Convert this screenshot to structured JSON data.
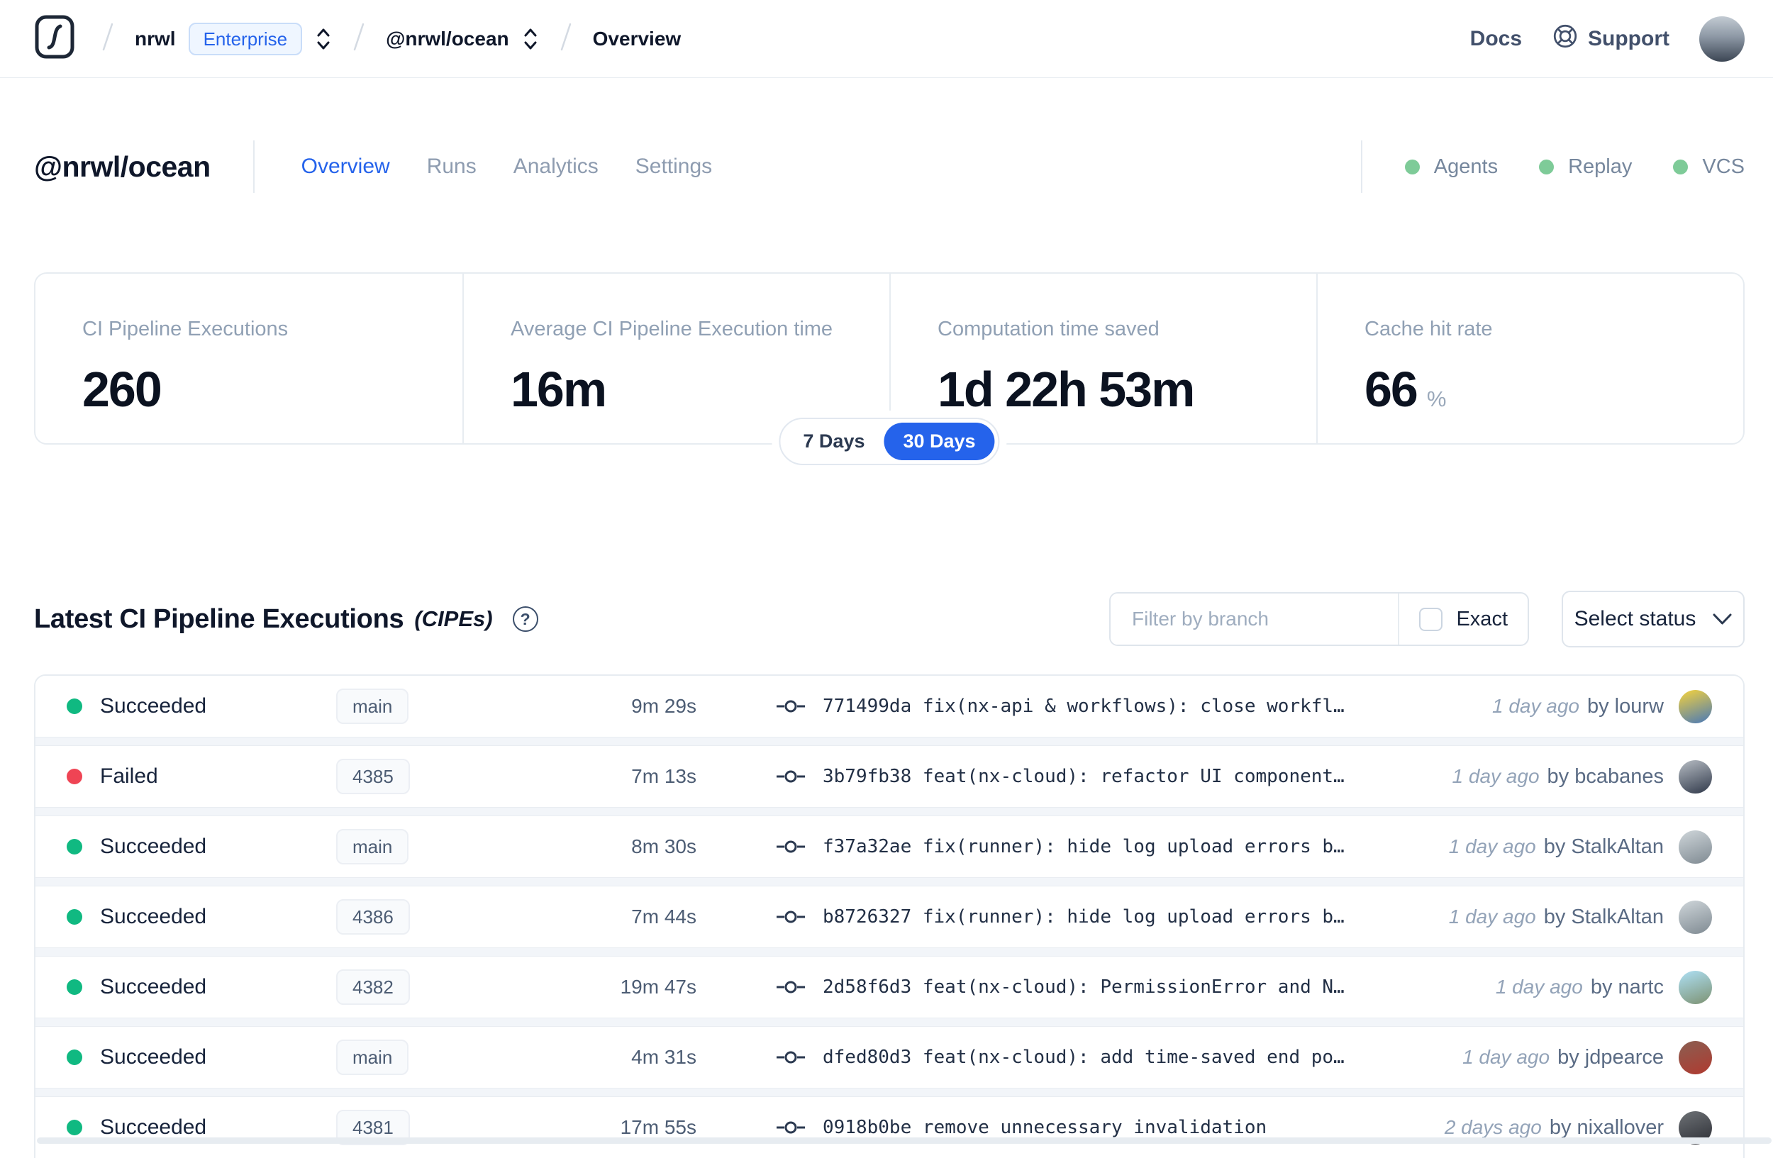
{
  "nav": {
    "breadcrumb": {
      "org": "nrwl",
      "org_badge": "Enterprise",
      "workspace": "@nrwl/ocean",
      "page": "Overview"
    },
    "links": {
      "docs": "Docs",
      "support": "Support"
    }
  },
  "workspace_header": {
    "title": "@nrwl/ocean",
    "tabs": [
      {
        "label": "Overview",
        "active": true
      },
      {
        "label": "Runs",
        "active": false
      },
      {
        "label": "Analytics",
        "active": false
      },
      {
        "label": "Settings",
        "active": false
      }
    ],
    "integrations": [
      {
        "label": "Agents"
      },
      {
        "label": "Replay"
      },
      {
        "label": "VCS"
      }
    ]
  },
  "stats": {
    "cards": [
      {
        "label": "CI Pipeline Executions",
        "value": "260",
        "unit": ""
      },
      {
        "label": "Average CI Pipeline Execution time",
        "value": "16m",
        "unit": ""
      },
      {
        "label": "Computation time saved",
        "value": "1d 22h 53m",
        "unit": ""
      },
      {
        "label": "Cache hit rate",
        "value": "66",
        "unit": "%"
      }
    ],
    "range_toggle": {
      "options": [
        "7 Days",
        "30 Days"
      ],
      "selected": "30 Days"
    }
  },
  "cipes": {
    "title": "Latest CI Pipeline Executions",
    "title_suffix": "(CIPEs)",
    "help_glyph": "?",
    "filter": {
      "placeholder": "Filter by branch",
      "exact_label": "Exact",
      "status_label": "Select status"
    },
    "rows": [
      {
        "status": "Succeeded",
        "result": "succeeded",
        "branch": "main",
        "duration": "9m 29s",
        "commit": "771499da fix(nx-api & workflows): close workfl…",
        "time": "1 day ago",
        "author": "by lourw",
        "avatar_colors": [
          "#f6d33c",
          "#4878b8"
        ]
      },
      {
        "status": "Failed",
        "result": "failed",
        "branch": "4385",
        "duration": "7m 13s",
        "commit": "3b79fb38 feat(nx-cloud): refactor UI component…",
        "time": "1 day ago",
        "author": "by bcabanes",
        "avatar_colors": [
          "#b7bdc4",
          "#30394a"
        ]
      },
      {
        "status": "Succeeded",
        "result": "succeeded",
        "branch": "main",
        "duration": "8m 30s",
        "commit": "f37a32ae fix(runner): hide log upload errors b…",
        "time": "1 day ago",
        "author": "by StalkAltan",
        "avatar_colors": [
          "#cfd6da",
          "#7f8a92"
        ]
      },
      {
        "status": "Succeeded",
        "result": "succeeded",
        "branch": "4386",
        "duration": "7m 44s",
        "commit": "b8726327 fix(runner): hide log upload errors b…",
        "time": "1 day ago",
        "author": "by StalkAltan",
        "avatar_colors": [
          "#cfd6da",
          "#7f8a92"
        ]
      },
      {
        "status": "Succeeded",
        "result": "succeeded",
        "branch": "4382",
        "duration": "19m 47s",
        "commit": "2d58f6d3 feat(nx-cloud): PermissionError and N…",
        "time": "1 day ago",
        "author": "by nartc",
        "avatar_colors": [
          "#aee0f5",
          "#7d9272"
        ]
      },
      {
        "status": "Succeeded",
        "result": "succeeded",
        "branch": "main",
        "duration": "4m 31s",
        "commit": "dfed80d3 feat(nx-cloud): add time-saved end po…",
        "time": "1 day ago",
        "author": "by jdpearce",
        "avatar_colors": [
          "#8a5f52",
          "#b03a30"
        ]
      },
      {
        "status": "Succeeded",
        "result": "succeeded",
        "branch": "4381",
        "duration": "17m 55s",
        "commit": "0918b0be remove unnecessary invalidation",
        "time": "2 days ago",
        "author": "by nixallover",
        "avatar_colors": [
          "#6e7276",
          "#2c2e35"
        ]
      }
    ]
  },
  "colors": {
    "accent": "#2563eb",
    "succeeded_dot": "#10b981",
    "failed_dot": "#ef4454",
    "integration_dot": "#7ecb98"
  }
}
